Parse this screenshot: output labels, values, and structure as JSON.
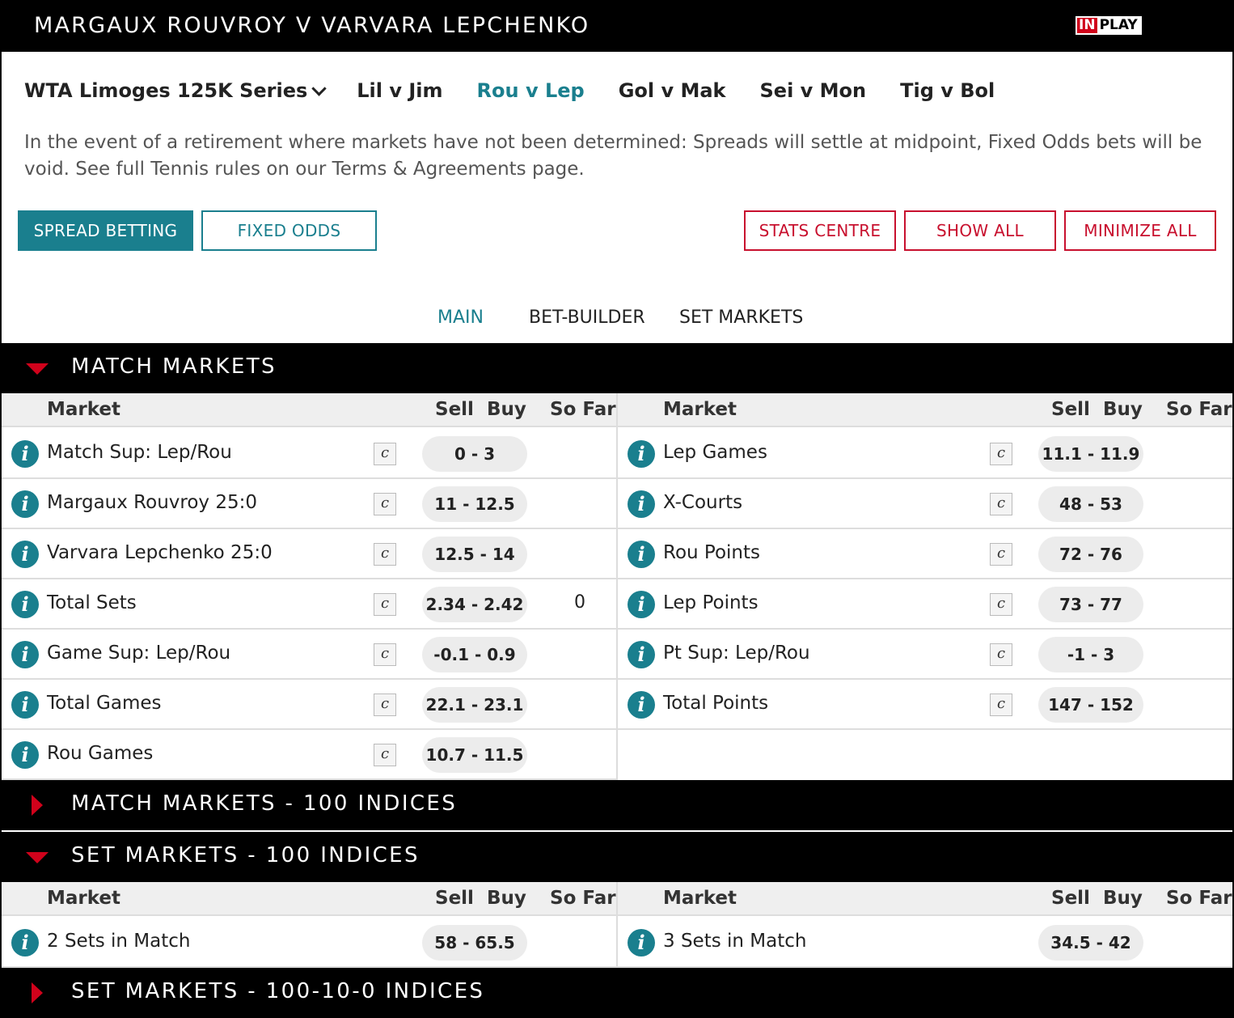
{
  "header": {
    "title": "MARGAUX ROUVROY V VARVARA LEPCHENKO",
    "inplay_in": "IN",
    "inplay_play": "PLAY"
  },
  "nav": {
    "competition": "WTA Limoges 125K Series",
    "matches": [
      "Lil v Jim",
      "Rou v Lep",
      "Gol v Mak",
      "Sei v Mon",
      "Tig v Bol"
    ],
    "active_match": "Rou v Lep"
  },
  "notice": "In the event of a retirement where markets have not been determined: Spreads will settle at midpoint, Fixed Odds bets will be void. See full Tennis rules on our Terms & Agreements page.",
  "buttons": {
    "spread": "SPREAD BETTING",
    "fixed": "FIXED ODDS",
    "stats": "STATS CENTRE",
    "show_all": "SHOW ALL",
    "minimize_all": "MINIMIZE ALL"
  },
  "subtabs": {
    "main": "MAIN",
    "bet_builder": "BET-BUILDER",
    "set_markets": "SET MARKETS",
    "active": "MAIN"
  },
  "columns": {
    "market": "Market",
    "sell_buy": "Sell  Buy",
    "so_far": "So Far"
  },
  "info_glyph": "i",
  "c_glyph": "c",
  "sections": {
    "match_markets": {
      "title": "MATCH MARKETS",
      "left": [
        {
          "name": "Match Sup: Lep/Rou",
          "price": "0 - 3",
          "so_far": ""
        },
        {
          "name": "Margaux Rouvroy 25:0",
          "price": "11 - 12.5",
          "so_far": ""
        },
        {
          "name": "Varvara Lepchenko 25:0",
          "price": "12.5 - 14",
          "so_far": ""
        },
        {
          "name": "Total Sets",
          "price": "2.34 - 2.42",
          "so_far": "0"
        },
        {
          "name": "Game Sup: Lep/Rou",
          "price": "-0.1 - 0.9",
          "so_far": ""
        },
        {
          "name": "Total Games",
          "price": "22.1 - 23.1",
          "so_far": ""
        },
        {
          "name": "Rou Games",
          "price": "10.7 - 11.5",
          "so_far": ""
        }
      ],
      "right": [
        {
          "name": "Lep Games",
          "price": "11.1 - 11.9",
          "so_far": ""
        },
        {
          "name": "X-Courts",
          "price": "48 - 53",
          "so_far": ""
        },
        {
          "name": "Rou Points",
          "price": "72 - 76",
          "so_far": ""
        },
        {
          "name": "Lep Points",
          "price": "73 - 77",
          "so_far": ""
        },
        {
          "name": "Pt Sup: Lep/Rou",
          "price": "-1 - 3",
          "so_far": ""
        },
        {
          "name": "Total Points",
          "price": "147 - 152",
          "so_far": ""
        }
      ]
    },
    "match_markets_100": {
      "title": "MATCH MARKETS - 100 INDICES"
    },
    "set_markets_100": {
      "title": "SET MARKETS - 100 INDICES",
      "left": [
        {
          "name": "2 Sets in Match",
          "price": "58 - 65.5",
          "so_far": ""
        }
      ],
      "right": [
        {
          "name": "3 Sets in Match",
          "price": "34.5 - 42",
          "so_far": ""
        }
      ]
    },
    "set_markets_100_10_0": {
      "title": "SET MARKETS - 100-10-0 INDICES"
    }
  }
}
